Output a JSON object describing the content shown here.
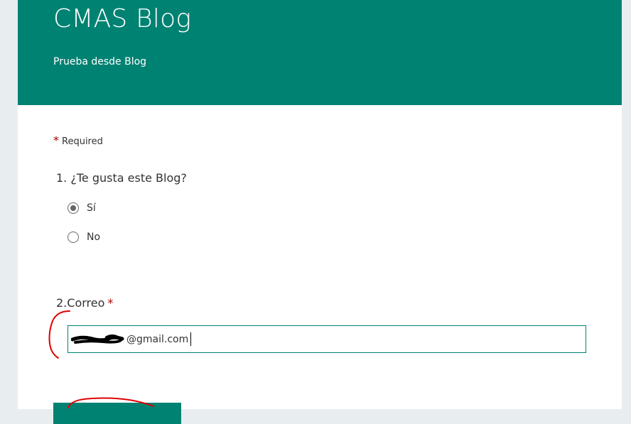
{
  "form": {
    "title": "CMAS Blog",
    "subtitle": "Prueba desde Blog",
    "required_star": "*",
    "required_label": "Required",
    "questions": [
      {
        "number": "1.",
        "text": "¿Te gusta este Blog?",
        "options": [
          {
            "label": "Sí",
            "selected": true
          },
          {
            "label": "No",
            "selected": false
          }
        ]
      },
      {
        "number": "2.",
        "text": "Correo",
        "required_star": "*",
        "value": "@gmail.com"
      }
    ]
  },
  "colors": {
    "header": "#008272",
    "required": "#a80000",
    "annotation": "#e00000"
  },
  "icons": {
    "radio_selected": "radio-selected-icon",
    "radio_unselected": "radio-unselected-icon"
  }
}
